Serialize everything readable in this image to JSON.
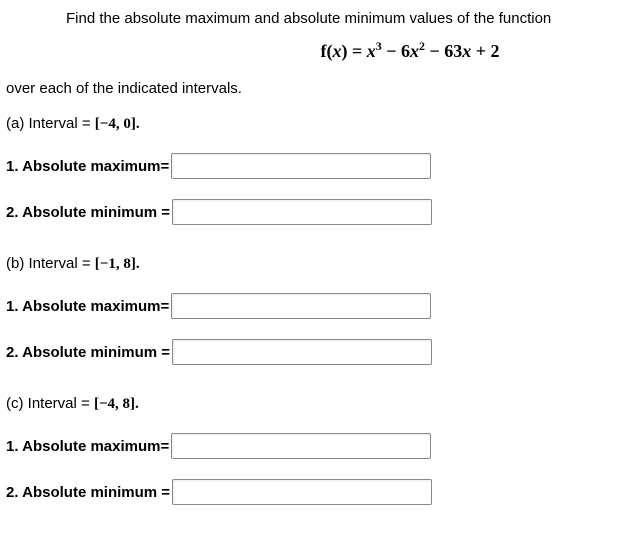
{
  "prompt": "Find the absolute maximum and absolute minimum values of the function",
  "sub_intro": "over each of the indicated intervals.",
  "formula_html": "<span class='rm'>f(</span>x<span class='rm'>)</span> <span class='rm'>=</span> x<sup><span class='rm'>3</span></sup> <span class='rm minus'>&minus;</span> <span class='rm'>6</span>x<sup><span class='rm'>2</span></sup> <span class='rm minus'>&minus;</span> <span class='rm'>63</span>x <span class='rm'>+ 2</span>",
  "parts": {
    "a": {
      "label_prefix": "(a) Interval = ",
      "interval": "[−4, 0]",
      "max_label": "1.  Absolute maximum=",
      "min_label": "2.  Absolute minimum =",
      "max_value": "",
      "min_value": ""
    },
    "b": {
      "label_prefix": "(b) Interval = ",
      "interval": "[−1, 8]",
      "max_label": "1.  Absolute maximum=",
      "min_label": "2.  Absolute minimum =",
      "max_value": "",
      "min_value": ""
    },
    "c": {
      "label_prefix": "(c) Interval = ",
      "interval": "[−4, 8]",
      "max_label": "1.  Absolute maximum=",
      "min_label": "2.  Absolute minimum =",
      "max_value": "",
      "min_value": ""
    }
  }
}
